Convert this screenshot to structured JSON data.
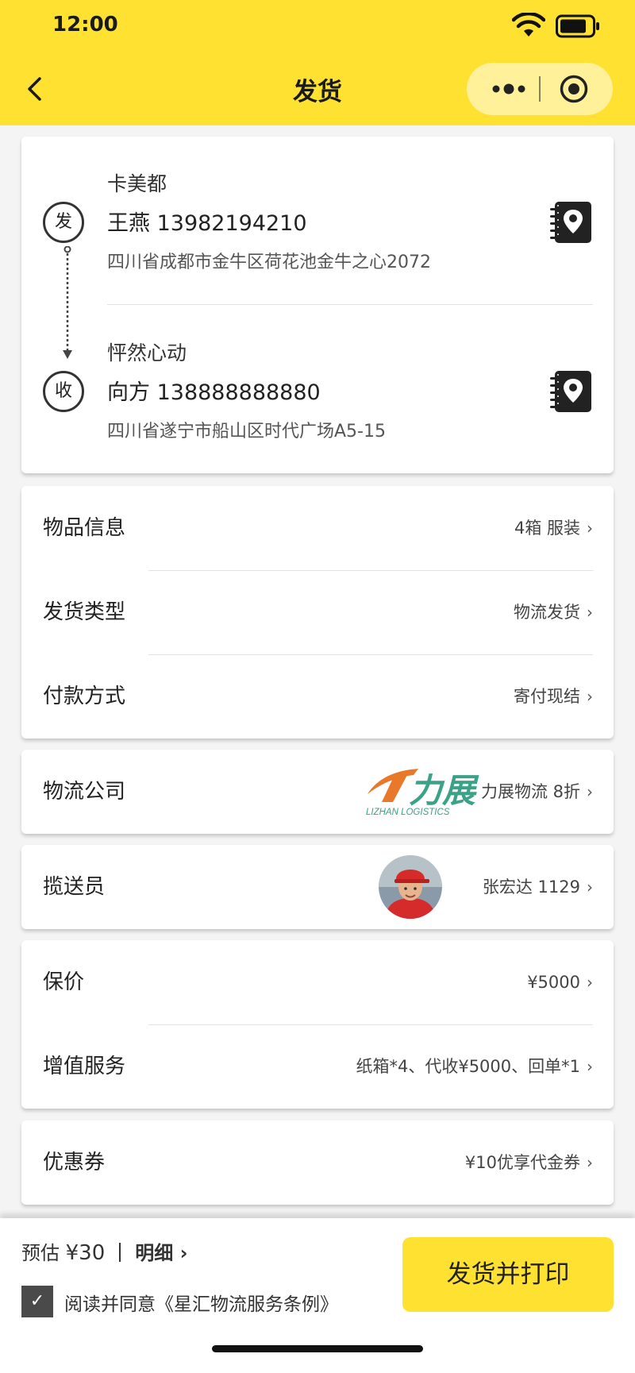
{
  "status_bar": {
    "time": "12:00"
  },
  "nav": {
    "title": "发货"
  },
  "sender": {
    "badge": "发",
    "name": "卡美都",
    "contact": "王燕  13982194210",
    "address": "四川省成都市金牛区荷花池金牛之心2072"
  },
  "receiver": {
    "badge": "收",
    "name": "怦然心动",
    "contact": "向方 138888888880",
    "address": "四川省遂宁市船山区时代广场A5-15"
  },
  "goods": {
    "item_label": "物品信息",
    "item_value": "4箱 服装",
    "type_label": "发货类型",
    "type_value": "物流发货",
    "pay_label": "付款方式",
    "pay_value": "寄付现结"
  },
  "logistics": {
    "label": "物流公司",
    "value": "力展物流 8折",
    "logo_text": "力展",
    "logo_sub": "LIZHAN LOGISTICS"
  },
  "courier": {
    "label": "揽送员",
    "value": "张宏达 1129"
  },
  "insure": {
    "insure_label": "保价",
    "insure_value": "¥5000",
    "vas_label": "增值服务",
    "vas_value": "纸箱*4、代收¥5000、回单*1"
  },
  "coupon": {
    "label": "优惠券",
    "value": "¥10优享代金券"
  },
  "footer": {
    "estimate_label": "预估",
    "estimate_price": "¥30",
    "detail_label": "明细",
    "agree_text": "阅读并同意《星汇物流服务条例》",
    "submit_label": "发货并打印"
  },
  "colors": {
    "brand_yellow": "#ffe131",
    "logo_orange": "#e8782a",
    "logo_green": "#3aa287"
  }
}
